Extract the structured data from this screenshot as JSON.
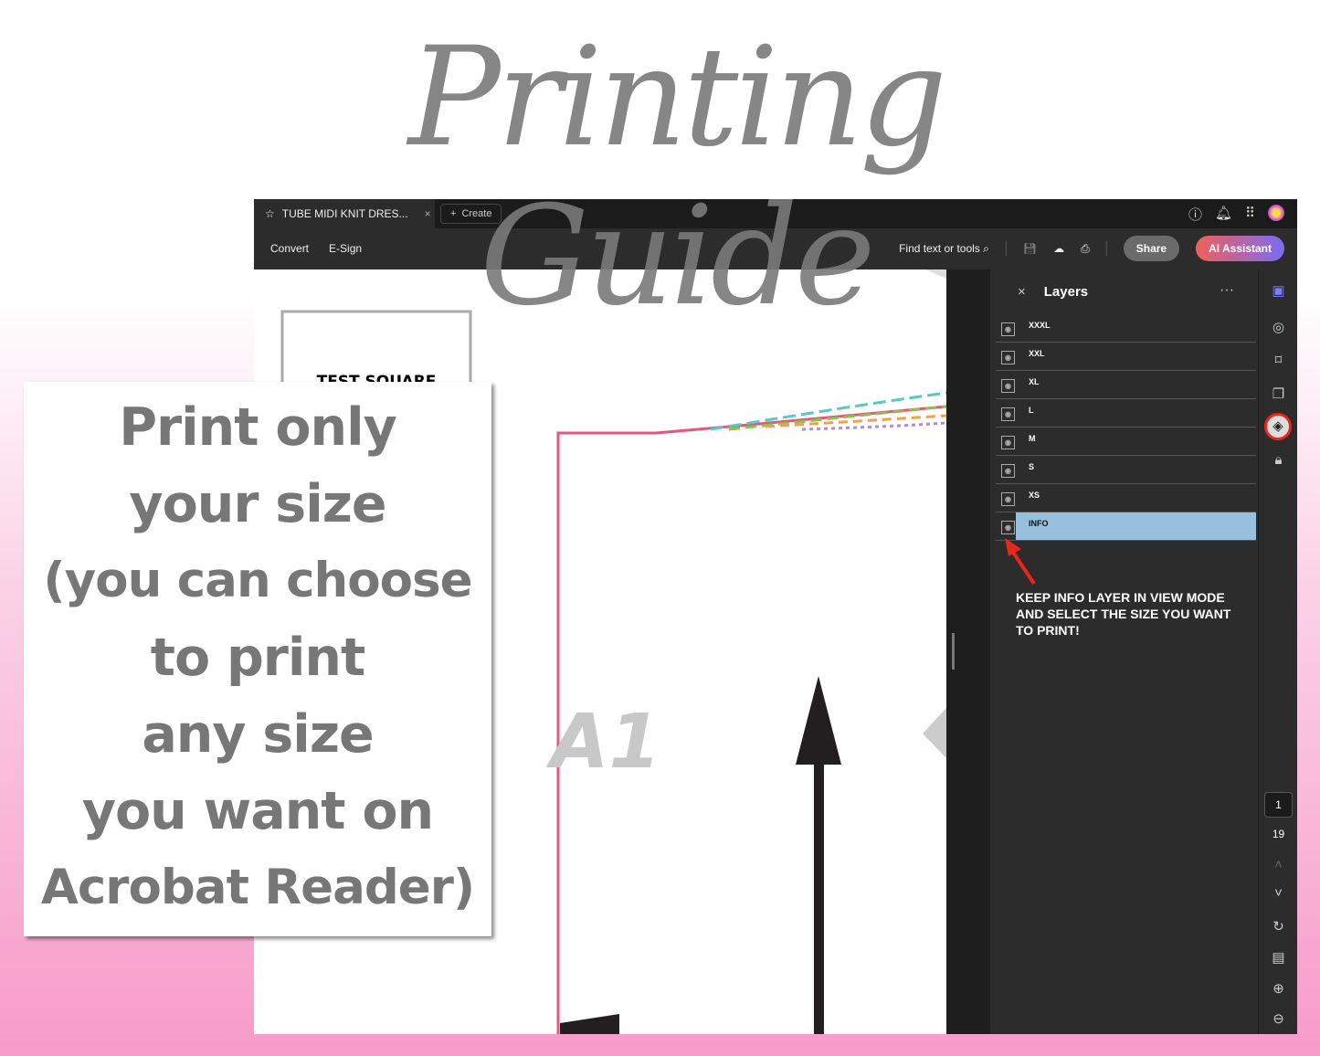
{
  "title": "Printing Guide",
  "tab": {
    "label": "TUBE MIDI KNIT DRES...",
    "close": "×",
    "create": "Create"
  },
  "toolbar": {
    "convert": "Convert",
    "esign": "E-Sign",
    "find": "Find text or tools",
    "share": "Share",
    "ai": "AI Assistant"
  },
  "document": {
    "test_square": "TEST SQUARE",
    "piece_label": "A1"
  },
  "layers": {
    "title": "Layers",
    "close": "×",
    "more": "···",
    "items": [
      "XXXL",
      "XXL",
      "XL",
      "L",
      "M",
      "S",
      "XS",
      "INFO"
    ],
    "selected": "INFO",
    "note": "KEEP INFO LAYER IN VIEW MODE AND SELECT THE SIZE YOU WANT TO PRINT!"
  },
  "pager": {
    "current": "1",
    "total": "19"
  },
  "callout": {
    "lines": [
      "Print only",
      "your size",
      "(you can choose",
      "to print",
      "any size",
      "you want on",
      "Acrobat Reader)"
    ]
  },
  "colors": {
    "accent_red": "#e8261c",
    "selected_layer": "#97c0de"
  }
}
